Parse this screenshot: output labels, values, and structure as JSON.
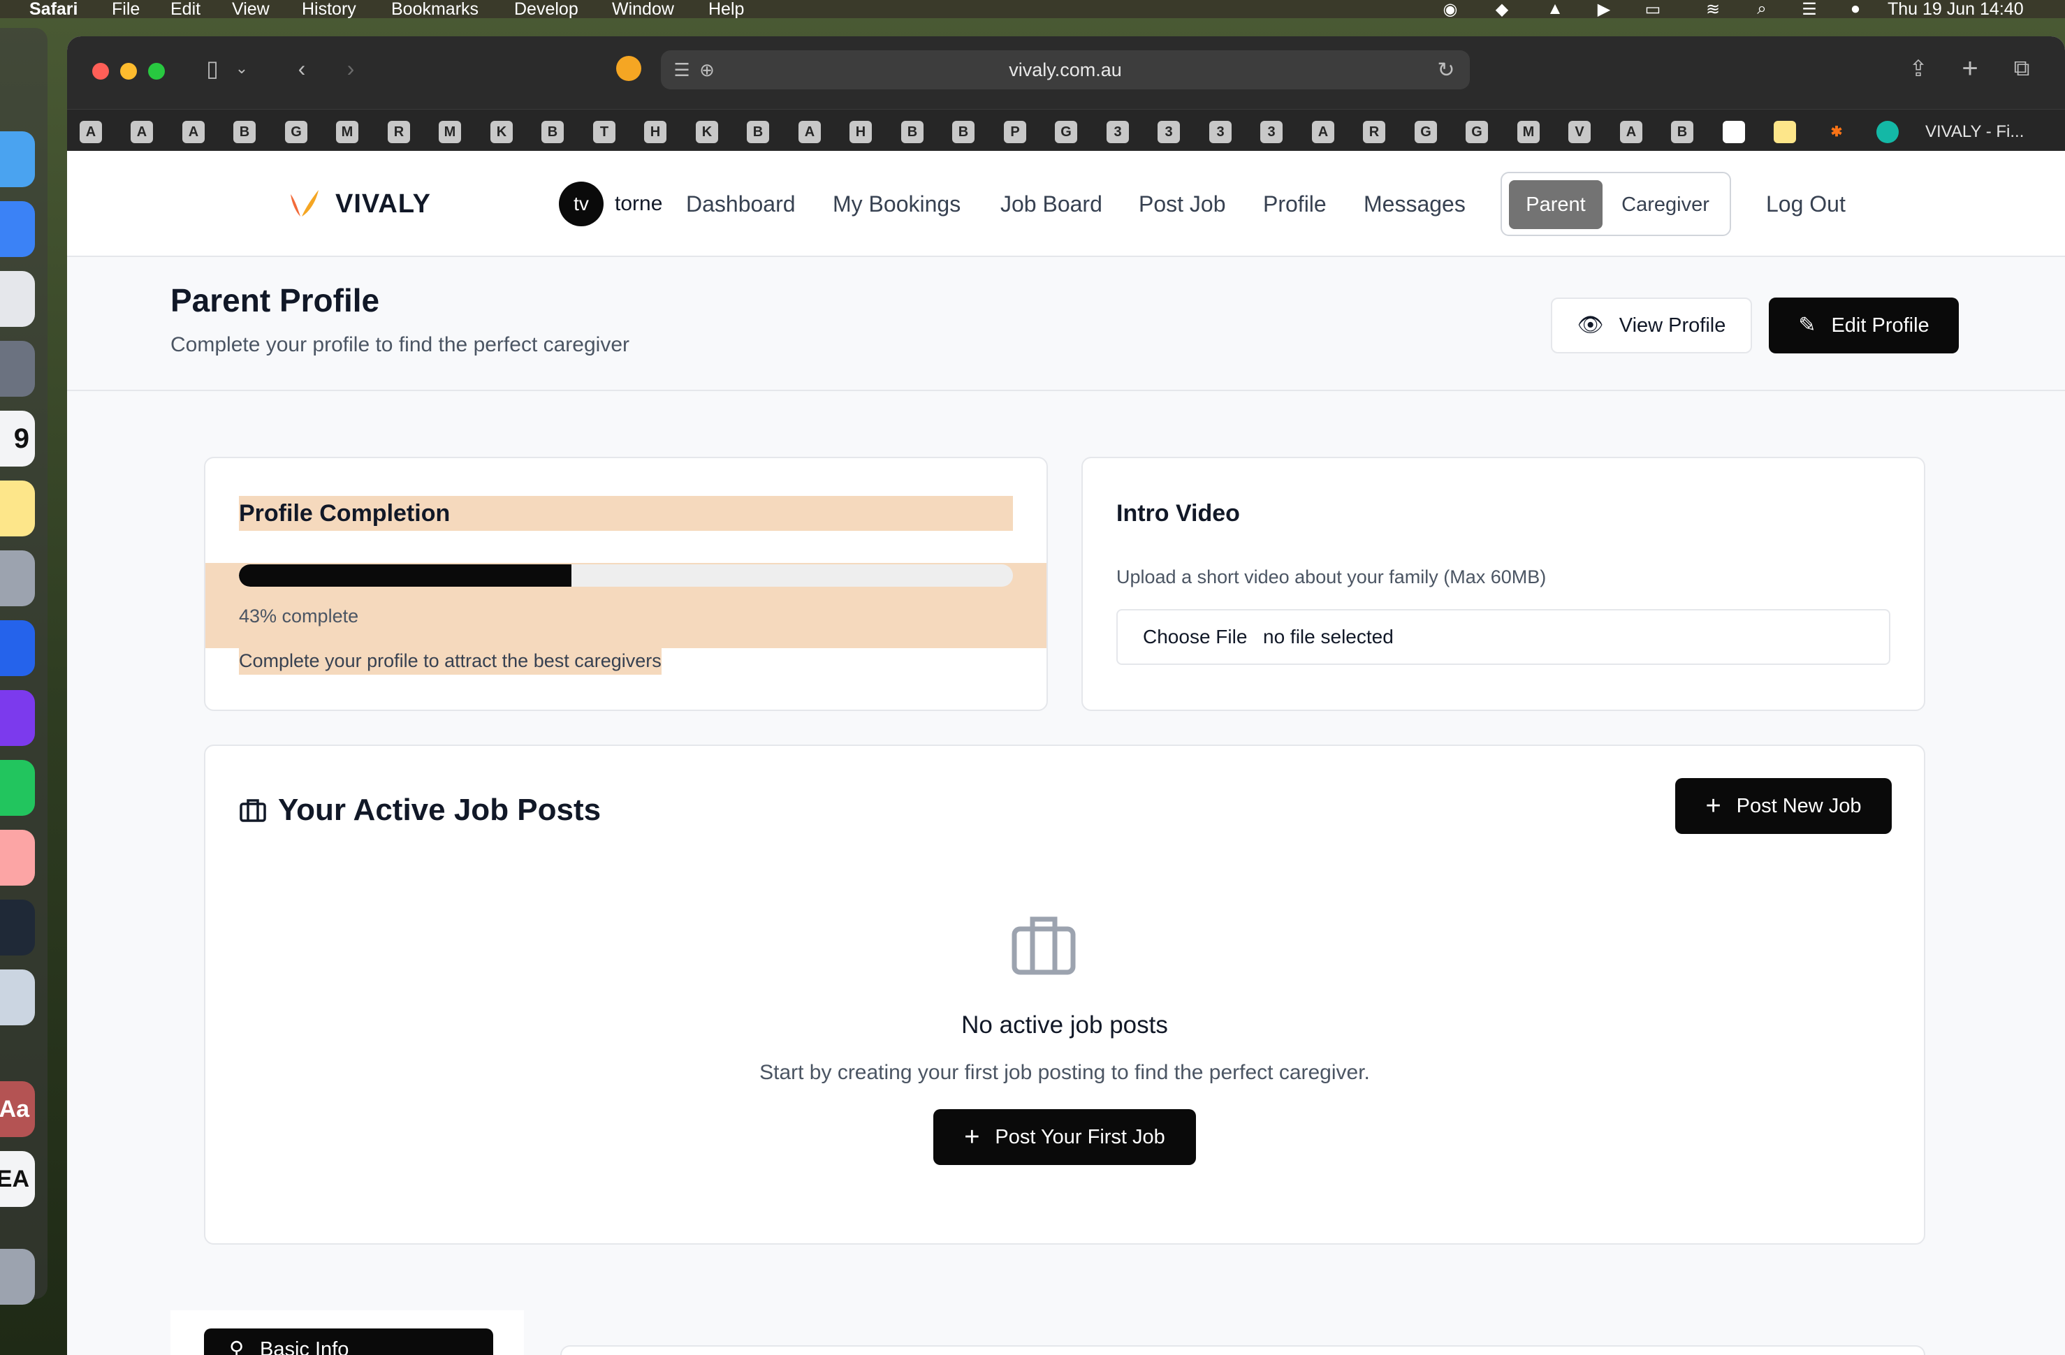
{
  "menubar": {
    "app": "Safari",
    "items": [
      "File",
      "Edit",
      "View",
      "History",
      "Bookmarks",
      "Develop",
      "Window",
      "Help"
    ],
    "clock": "Thu 19 Jun  14:40"
  },
  "browser": {
    "url": "vivaly.com.au",
    "favorites": [
      "A",
      "A",
      "A",
      "B",
      "G",
      "M",
      "R",
      "M",
      "K",
      "B",
      "T",
      "H",
      "K",
      "B",
      "A",
      "H",
      "B",
      "B",
      "P",
      "G",
      "3",
      "3",
      "3",
      "3",
      "A",
      "R",
      "G",
      "G",
      "M",
      "V",
      "A",
      "B"
    ],
    "tab_title": "VIVALY - Fi..."
  },
  "nav": {
    "brand": "VIVALY",
    "avatar_initials": "tv",
    "username": "torne",
    "links": [
      "Dashboard",
      "My Bookings",
      "Job Board",
      "Post Job",
      "Profile",
      "Messages"
    ],
    "role_toggle": {
      "parent": "Parent",
      "caregiver": "Caregiver",
      "active": "Parent"
    },
    "logout": "Log Out"
  },
  "header": {
    "title": "Parent Profile",
    "subtitle": "Complete your profile to find the perfect caregiver",
    "view_profile": "View Profile",
    "edit_profile": "Edit Profile"
  },
  "completion": {
    "title": "Profile Completion",
    "percent": 43,
    "percent_label": "43% complete",
    "hint": "Complete your profile to attract the best caregivers"
  },
  "intro_video": {
    "title": "Intro Video",
    "description": "Upload a short video about your family (Max 60MB)",
    "choose_file": "Choose File",
    "file_status": "no file selected"
  },
  "jobs": {
    "title": "Your Active Job Posts",
    "post_new": "Post New Job",
    "empty_title": "No active job posts",
    "empty_text": "Start by creating your first job posting to find the perfect caregiver.",
    "post_first": "Post Your First Job"
  },
  "sidebar": {
    "basic_info": "Basic Info"
  },
  "colors": {
    "accent": "#0a0a0a",
    "highlight": "#f5d9bd",
    "brand_orange": "#f26b3a"
  }
}
